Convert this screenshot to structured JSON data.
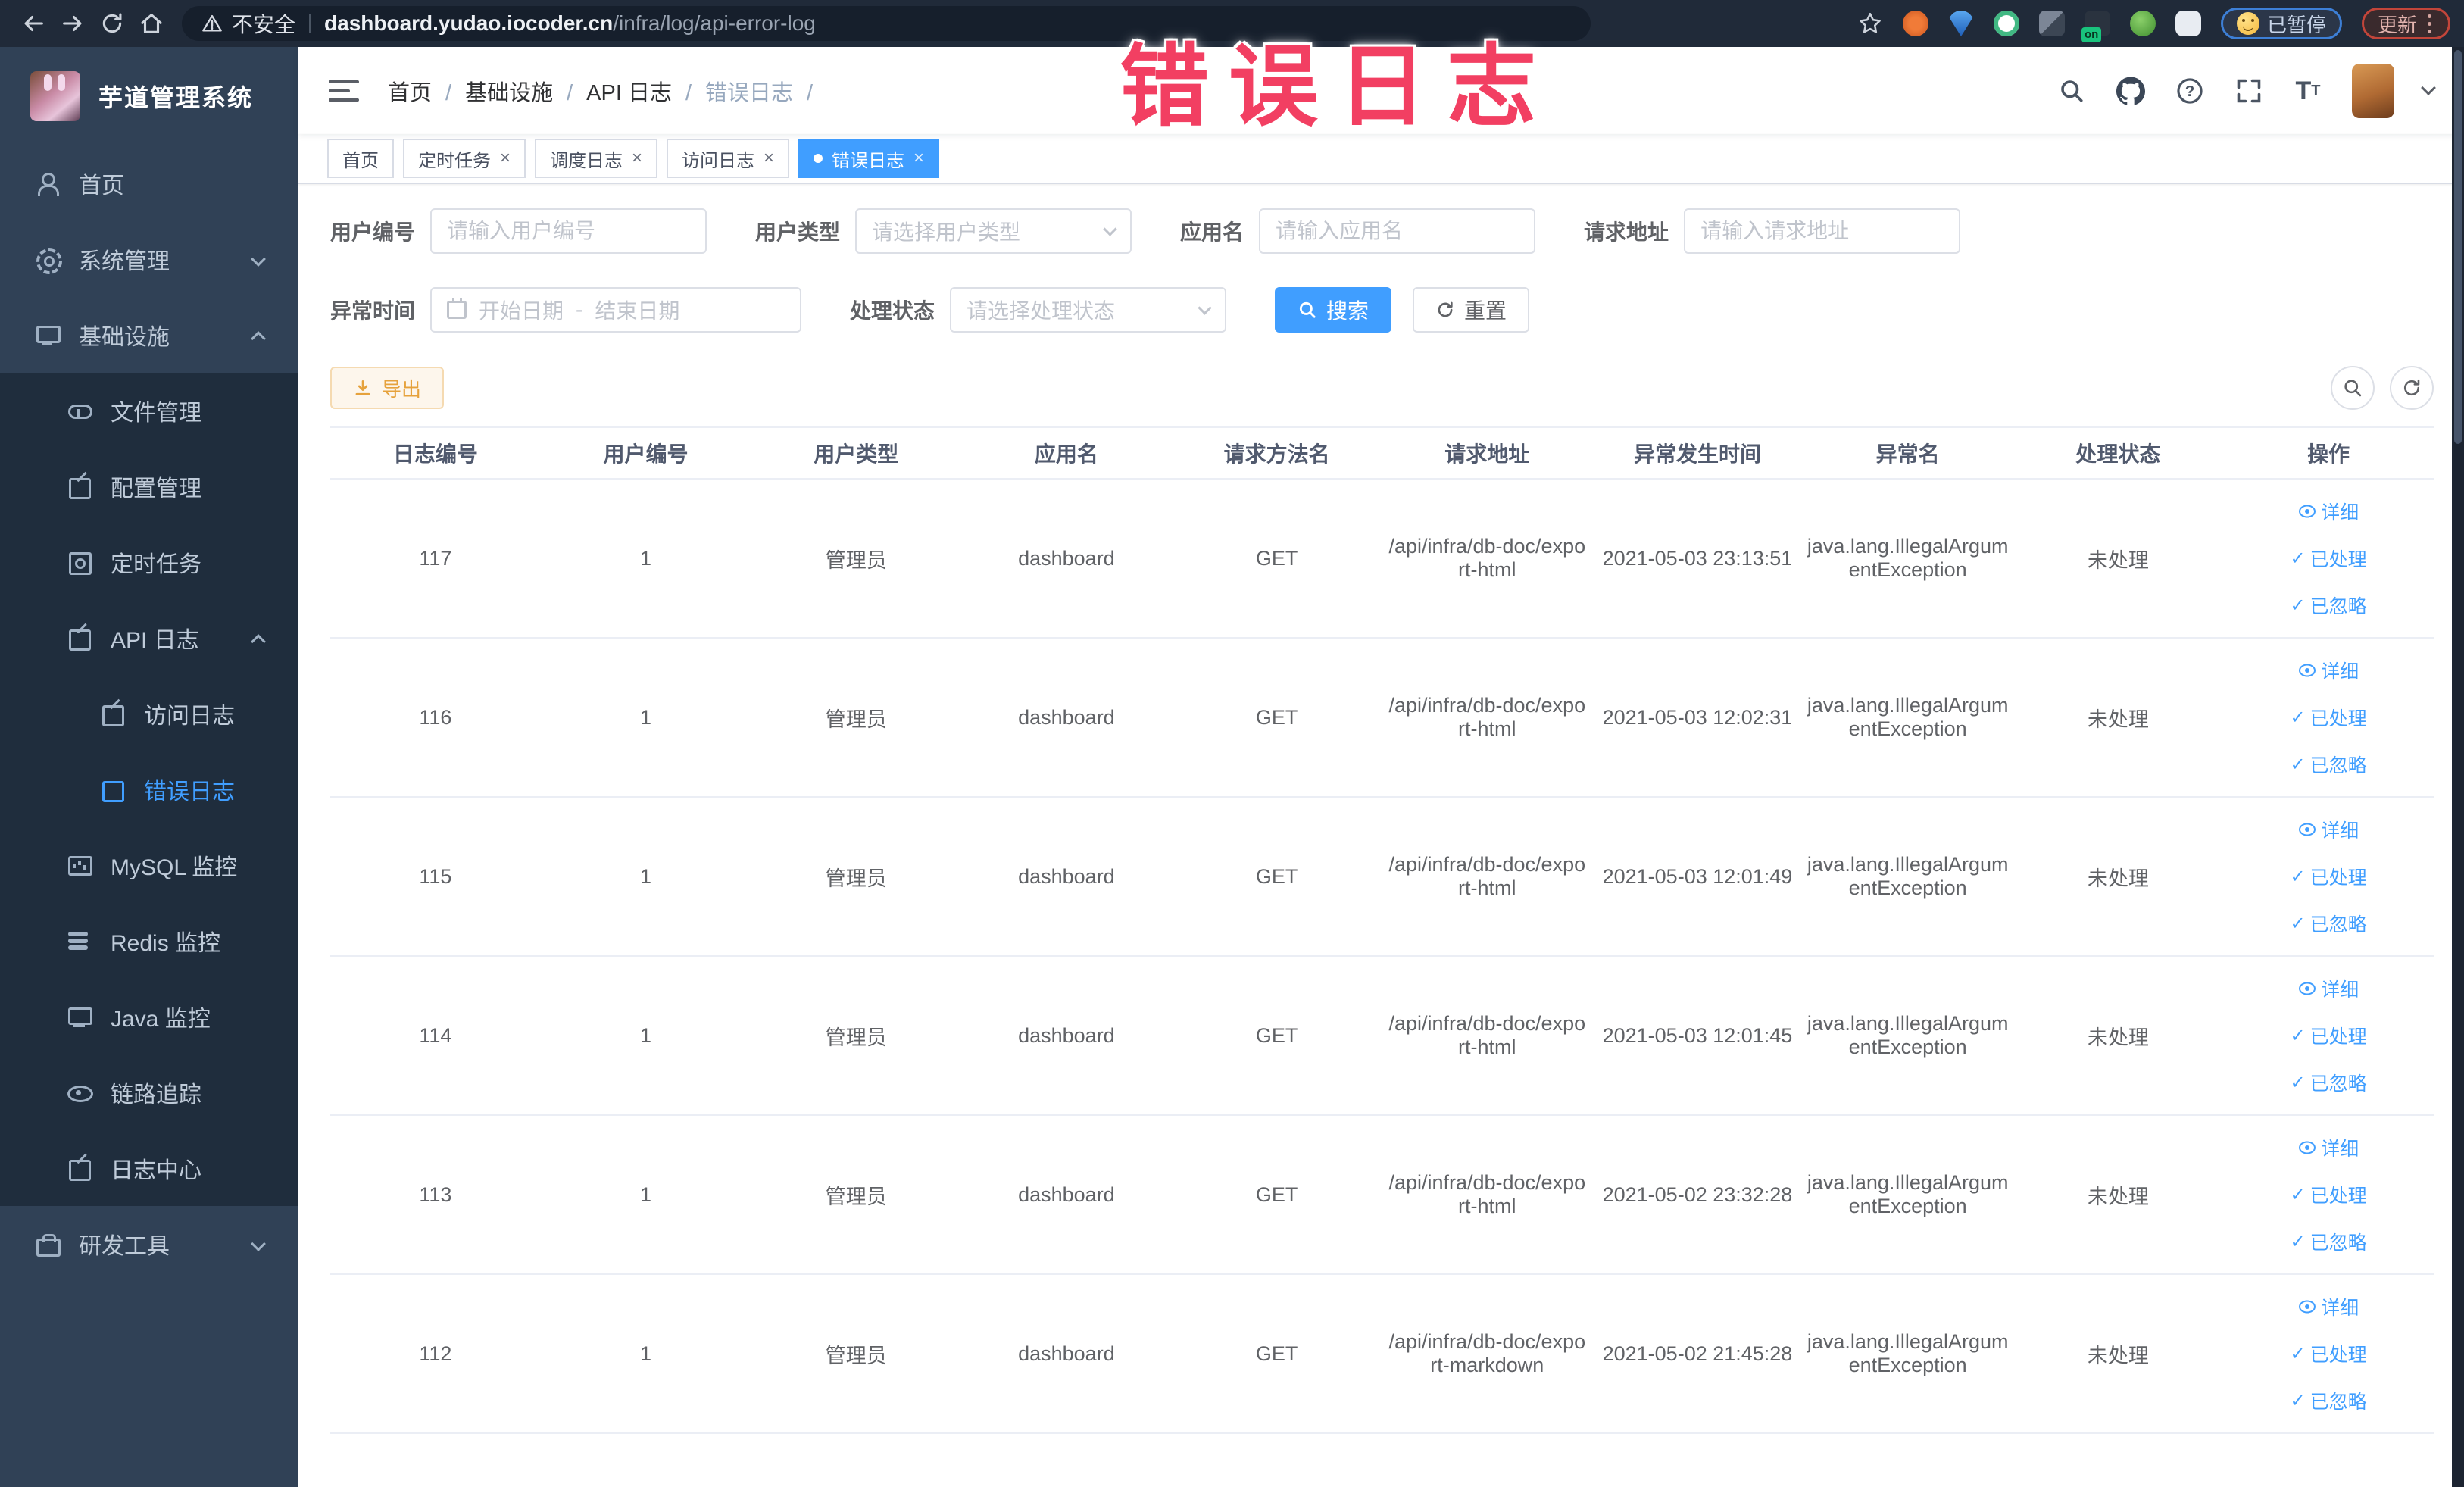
{
  "browser": {
    "insecure_label": "不安全",
    "url_domain": "dashboard.yudao.iocoder.cn",
    "url_path": "/infra/log/api-error-log",
    "on_badge": "on",
    "paused_badge": "已暂停",
    "update_badge": "更新"
  },
  "annotation": {
    "text": "错误日志",
    "color": "#f23f62"
  },
  "sidebar": {
    "title": "芋道管理系统",
    "items": [
      {
        "label": "首页",
        "icon": "peoples",
        "level": 0
      },
      {
        "label": "系统管理",
        "icon": "gear",
        "level": 0,
        "arrow": "down"
      },
      {
        "label": "基础设施",
        "icon": "monitor",
        "level": 0,
        "arrow": "up"
      },
      {
        "label": "文件管理",
        "icon": "cloud",
        "level": 1
      },
      {
        "label": "配置管理",
        "icon": "edit",
        "level": 1
      },
      {
        "label": "定时任务",
        "icon": "timer",
        "level": 1
      },
      {
        "label": "API 日志",
        "icon": "log",
        "level": 1,
        "arrow": "up"
      },
      {
        "label": "访问日志",
        "icon": "log",
        "level": 2
      },
      {
        "label": "错误日志",
        "icon": "log",
        "level": 2,
        "active": true
      },
      {
        "label": "MySQL 监控",
        "icon": "chart",
        "level": 1
      },
      {
        "label": "Redis 监控",
        "icon": "redis",
        "level": 1
      },
      {
        "label": "Java 监控",
        "icon": "java",
        "level": 1
      },
      {
        "label": "链路追踪",
        "icon": "eye",
        "level": 1
      },
      {
        "label": "日志中心",
        "icon": "log",
        "level": 1
      },
      {
        "label": "研发工具",
        "icon": "tool",
        "level": 0,
        "arrow": "down"
      }
    ]
  },
  "breadcrumb": {
    "items": [
      "首页",
      "基础设施",
      "API 日志",
      "错误日志"
    ]
  },
  "tabs": [
    {
      "label": "首页",
      "closable": false
    },
    {
      "label": "定时任务",
      "closable": true
    },
    {
      "label": "调度日志",
      "closable": true
    },
    {
      "label": "访问日志",
      "closable": true
    },
    {
      "label": "错误日志",
      "closable": true,
      "active": true
    }
  ],
  "filters": {
    "user_id": {
      "label": "用户编号",
      "placeholder": "请输入用户编号"
    },
    "user_type": {
      "label": "用户类型",
      "placeholder": "请选择用户类型"
    },
    "app_name": {
      "label": "应用名",
      "placeholder": "请输入应用名"
    },
    "request_url": {
      "label": "请求地址",
      "placeholder": "请输入请求地址"
    },
    "exception_time": {
      "label": "异常时间",
      "start_placeholder": "开始日期",
      "separator": "-",
      "end_placeholder": "结束日期"
    },
    "process_status": {
      "label": "处理状态",
      "placeholder": "请选择处理状态"
    },
    "search_label": "搜索",
    "reset_label": "重置"
  },
  "toolbar": {
    "export_label": "导出"
  },
  "table": {
    "columns": [
      "日志编号",
      "用户编号",
      "用户类型",
      "应用名",
      "请求方法名",
      "请求地址",
      "异常发生时间",
      "异常名",
      "处理状态",
      "操作"
    ],
    "actions": [
      "详细",
      "已处理",
      "已忽略"
    ],
    "rows": [
      {
        "log_id": "117",
        "user_id": "1",
        "user_type": "管理员",
        "app_name": "dashboard",
        "method": "GET",
        "url": "/api/infra/db-doc/export-html",
        "time": "2021-05-03 23:13:51",
        "exception": "java.lang.IllegalArgumentException",
        "status": "未处理"
      },
      {
        "log_id": "116",
        "user_id": "1",
        "user_type": "管理员",
        "app_name": "dashboard",
        "method": "GET",
        "url": "/api/infra/db-doc/export-html",
        "time": "2021-05-03 12:02:31",
        "exception": "java.lang.IllegalArgumentException",
        "status": "未处理"
      },
      {
        "log_id": "115",
        "user_id": "1",
        "user_type": "管理员",
        "app_name": "dashboard",
        "method": "GET",
        "url": "/api/infra/db-doc/export-html",
        "time": "2021-05-03 12:01:49",
        "exception": "java.lang.IllegalArgumentException",
        "status": "未处理"
      },
      {
        "log_id": "114",
        "user_id": "1",
        "user_type": "管理员",
        "app_name": "dashboard",
        "method": "GET",
        "url": "/api/infra/db-doc/export-html",
        "time": "2021-05-03 12:01:45",
        "exception": "java.lang.IllegalArgumentException",
        "status": "未处理"
      },
      {
        "log_id": "113",
        "user_id": "1",
        "user_type": "管理员",
        "app_name": "dashboard",
        "method": "GET",
        "url": "/api/infra/db-doc/export-html",
        "time": "2021-05-02 23:32:28",
        "exception": "java.lang.IllegalArgumentException",
        "status": "未处理"
      },
      {
        "log_id": "112",
        "user_id": "1",
        "user_type": "管理员",
        "app_name": "dashboard",
        "method": "GET",
        "url": "/api/infra/db-doc/export-markdown",
        "time": "2021-05-02 21:45:28",
        "exception": "java.lang.IllegalArgumentException",
        "status": "未处理"
      }
    ]
  }
}
